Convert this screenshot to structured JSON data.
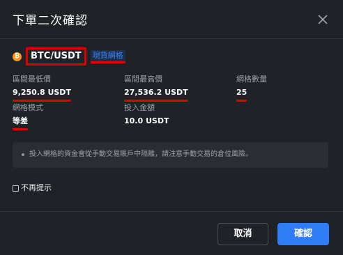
{
  "dialog": {
    "title": "下單二次確認",
    "close_icon": "close-icon"
  },
  "pair": {
    "coin_icon": "bitcoin-icon",
    "coin_symbol": "₿",
    "name": "BTC/USDT",
    "tag": "現貨網格"
  },
  "fields": {
    "min_price": {
      "label": "區間最低價",
      "value": "9,250.8 USDT"
    },
    "max_price": {
      "label": "區間最高價",
      "value": "27,536.2 USDT"
    },
    "grid_count": {
      "label": "網格數量",
      "value": "25"
    },
    "grid_mode": {
      "label": "網格模式",
      "value": "等差"
    },
    "investment": {
      "label": "投入金額",
      "value": "10.0 USDT"
    }
  },
  "notice": {
    "text": "投入網格的資金會從手動交易賬戶中隔離，請注意手動交易的倉位風險。"
  },
  "checkbox": {
    "label": "不再提示",
    "checked": false
  },
  "buttons": {
    "cancel": "取消",
    "confirm": "確認"
  },
  "colors": {
    "background": "#1f2227",
    "accent": "#2f7cf6",
    "annotation_red": "#e10000",
    "tag_blue": "#3b82f6",
    "bitcoin_orange": "#f7931a"
  }
}
